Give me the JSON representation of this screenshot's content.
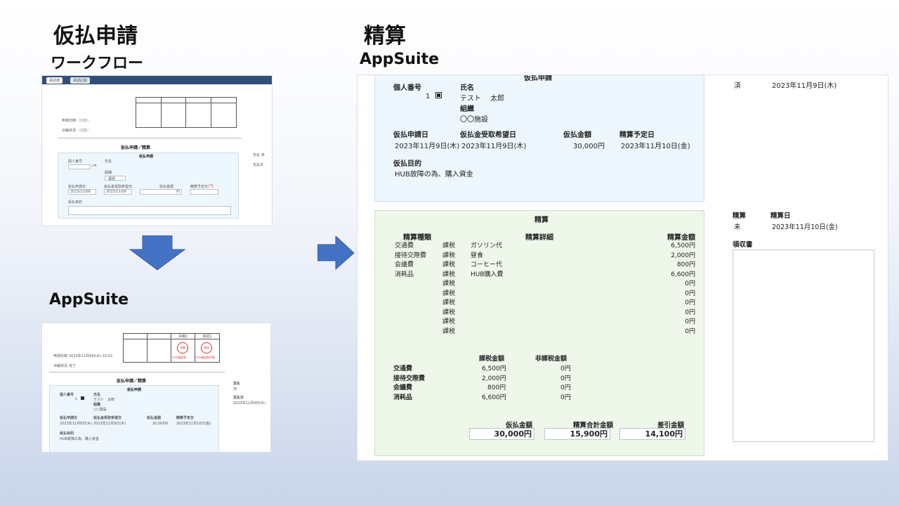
{
  "titles": {
    "left_main": "仮払申請",
    "workflow": "ワークフロー",
    "appsuite_left": "AppSuite",
    "right_main": "精算",
    "appsuite_right": "AppSuite"
  },
  "wf": {
    "tabs": [
      "承認書",
      "承認記録"
    ],
    "apply_date_label": "申請日時",
    "apply_date_val": "(自動)",
    "status_label": "決裁状況",
    "status_val": "(自動)",
    "section": "仮払申請／精算",
    "form_title": "仮払申請",
    "person_label": "個人番号",
    "name_label": "氏名",
    "org_label": "組織",
    "org_select": "選択",
    "apply_day_label": "仮払申請日",
    "apply_day_val": "2023/11/09",
    "hope_label": "仮払金受取希望日",
    "hope_val": "2023/11/09",
    "amount_label": "仮払金額",
    "amount_unit": "円",
    "plan_label": "精算予定日",
    "required_mark": "(*)",
    "purpose_label": "仮払目的",
    "side1": "支払",
    "side1_val": "未",
    "side2": "支払日"
  },
  "as_small": {
    "stamp_headers": [
      "決裁2",
      "承認1"
    ],
    "stamp1": "決裁",
    "stamp1_sub": "ＯＯ施設長",
    "stamp2": "承認",
    "stamp2_sub": "ＯＯ施設長代理",
    "apply_date_label": "申請日時",
    "apply_date_val": "2023年11月9日(木) 10:02",
    "status_label": "決裁状況",
    "status_val": "完了",
    "section": "仮払申請／精算",
    "form_title": "仮払申請",
    "person_label": "個人番号",
    "person_val": "1",
    "name_label": "氏名",
    "name_val": "テスト　太郎",
    "org_label": "組織",
    "org_val": "○○施設",
    "apply_day_label": "仮払申請日",
    "apply_day_val": "2023年11月9日(木)",
    "hope_label": "仮払金受取希望日",
    "hope_val": "2023年11月9日(木)",
    "amount_label": "仮払金額",
    "amount_val": "30,000円",
    "plan_label": "精算予定日",
    "plan_val": "2023年11月10日(金)",
    "purpose_label": "仮払目的",
    "purpose_val": "HUB故障の為、購入資金",
    "side1": "支払",
    "side1_val": "済",
    "side2": "支払日",
    "side2_val": "2023年11月9日(木)"
  },
  "big": {
    "top_title": "仮払申請",
    "person_label": "個人番号",
    "person_val": "1",
    "name_label": "氏名",
    "name_val": "テスト　 太郎",
    "org_label": "組織",
    "org_val": "〇〇施設",
    "apply_day_label": "仮払申請日",
    "apply_day_val": "2023年11月9日(木)",
    "hope_label": "仮払金受取希望日",
    "hope_val": "2023年11月9日(木)",
    "amount_label": "仮払金額",
    "amount_val": "30,000円",
    "plan_label": "精算予定日",
    "plan_val": "2023年11月10日(金)",
    "purpose_label": "仮払目的",
    "purpose_val": "HUB故障の為、購入資金",
    "pay_val": "済",
    "pay_date_val": "2023年11月9日(木)",
    "settle_title": "精算",
    "col_kind": "精算種類",
    "col_detail": "精算詳細",
    "col_amount": "精算金額",
    "rows": [
      {
        "kind": "交通費",
        "tax": "課税",
        "detail": "ガソリン代",
        "amount": "6,500円"
      },
      {
        "kind": "接待交際費",
        "tax": "課税",
        "detail": "昼食",
        "amount": "2,000円"
      },
      {
        "kind": "会議費",
        "tax": "課税",
        "detail": "コーヒー代",
        "amount": "800円"
      },
      {
        "kind": "消耗品",
        "tax": "課税",
        "detail": "HUB購入費",
        "amount": "6,600円"
      },
      {
        "kind": "",
        "tax": "課税",
        "detail": "",
        "amount": "0円"
      },
      {
        "kind": "",
        "tax": "課税",
        "detail": "",
        "amount": "0円"
      },
      {
        "kind": "",
        "tax": "課税",
        "detail": "",
        "amount": "0円"
      },
      {
        "kind": "",
        "tax": "課税",
        "detail": "",
        "amount": "0円"
      },
      {
        "kind": "",
        "tax": "課税",
        "detail": "",
        "amount": "0円"
      },
      {
        "kind": "",
        "tax": "課税",
        "detail": "",
        "amount": "0円"
      }
    ],
    "sum_col_tax": "課税金額",
    "sum_col_nontax": "非課税金額",
    "sums": [
      {
        "kind": "交通費",
        "tax": "6,500円",
        "nontax": "0円"
      },
      {
        "kind": "接待交際費",
        "tax": "2,000円",
        "nontax": "0円"
      },
      {
        "kind": "会議費",
        "tax": "800円",
        "nontax": "0円"
      },
      {
        "kind": "消耗品",
        "tax": "6,600円",
        "nontax": "0円"
      }
    ],
    "total_advance_label": "仮払金額",
    "total_advance_val": "30,000円",
    "total_settle_label": "精算合計金額",
    "total_settle_val": "15,900円",
    "total_diff_label": "差引金額",
    "total_diff_val": "14,100円",
    "side_settle_label": "精算",
    "side_settle_val": "未",
    "side_date_label": "精算日",
    "side_date_val": "2023年11月10日(金)",
    "receipt_label": "領収書"
  }
}
